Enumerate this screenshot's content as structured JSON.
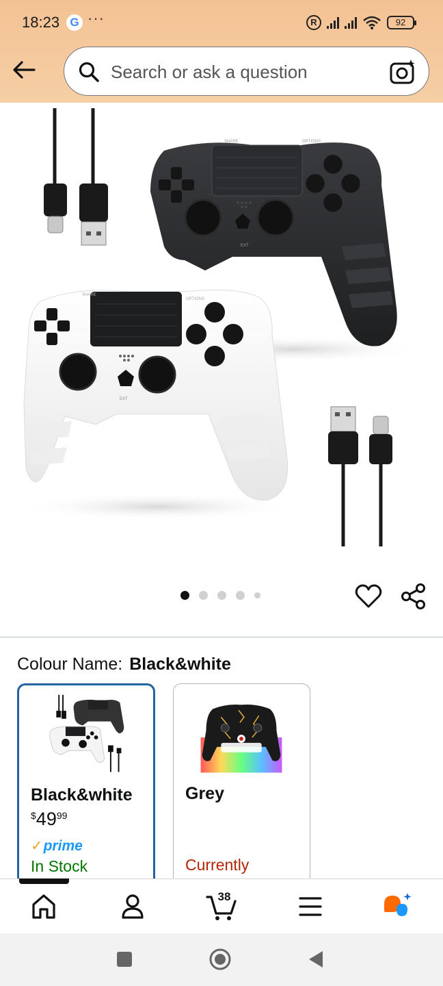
{
  "status_bar": {
    "time": "18:23",
    "google_badge": "G",
    "more": "···",
    "battery": "92",
    "wifi_label": "6"
  },
  "search": {
    "placeholder": "Search or ask a question"
  },
  "product": {
    "carousel": {
      "total": 5,
      "active_index": 0
    },
    "controller_labels": {
      "share": "SHARE",
      "options": "OPTIONS",
      "ext": "EXT"
    }
  },
  "variation": {
    "label": "Colour Name:",
    "selected_value": "Black&white",
    "options": [
      {
        "name": "Black&white",
        "price_currency": "$",
        "price_whole": "49",
        "price_fraction": "99",
        "prime": "prime",
        "availability": "In Stock",
        "selected": true
      },
      {
        "name": "Grey",
        "availability": "Currently",
        "selected": false
      }
    ]
  },
  "bottom_nav": {
    "items": [
      "home",
      "account",
      "cart",
      "menu",
      "rufus"
    ],
    "cart_count": "38",
    "active": "home"
  },
  "colors": {
    "header": "#f3c294",
    "accent_blue": "#2162a1",
    "in_stock": "#007600",
    "unavailable": "#b12704",
    "prime": "#1a98ff"
  }
}
